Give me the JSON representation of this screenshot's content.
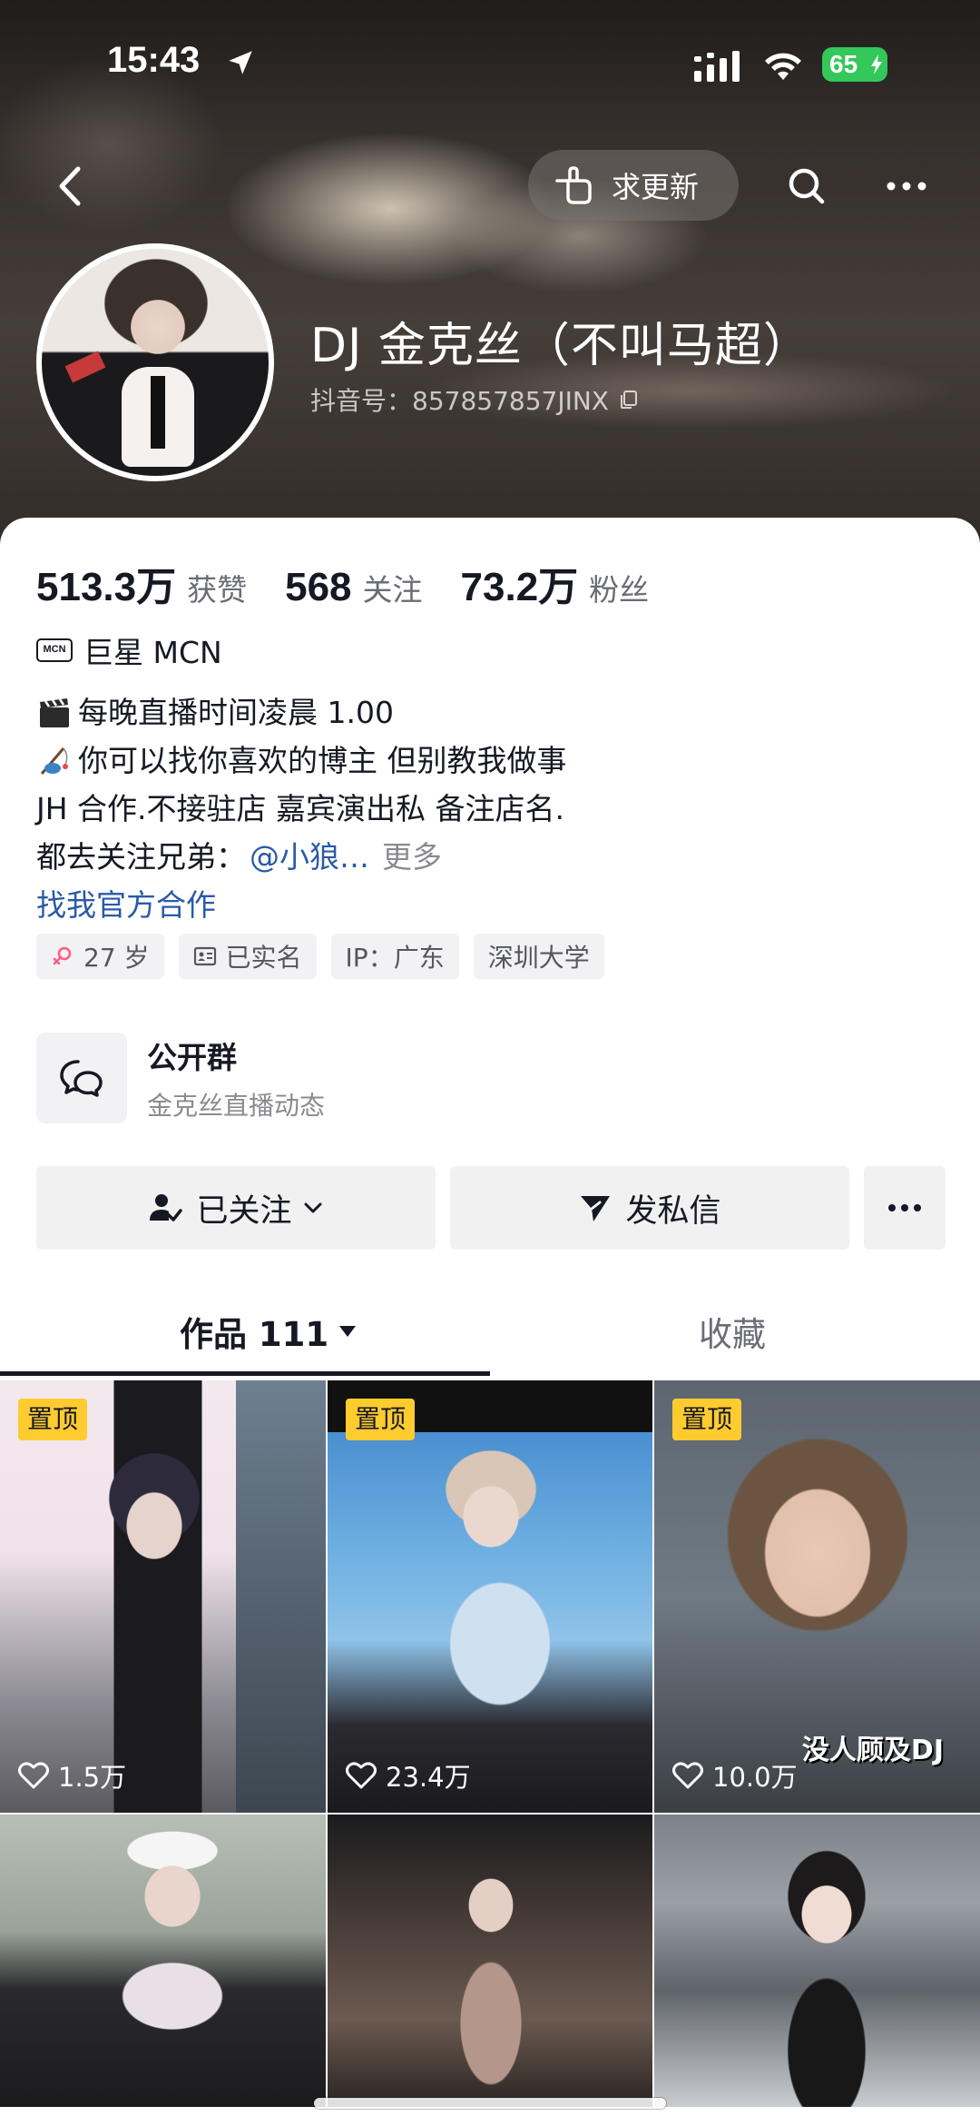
{
  "status_bar": {
    "time": "15:43",
    "battery": "65"
  },
  "header": {
    "update_label": "求更新"
  },
  "profile": {
    "name": "DJ 金克丝（不叫马超）",
    "douyin_id": "抖音号：857857857JINX"
  },
  "stats": [
    {
      "value": "513.3万",
      "label": "获赞"
    },
    {
      "value": "568",
      "label": "关注"
    },
    {
      "value": "73.2万",
      "label": "粉丝"
    }
  ],
  "mcn": {
    "badge": "MCN",
    "text": "巨星 MCN"
  },
  "bio": {
    "line1": "每晚直播时间凌晨 1.00",
    "line2": "你可以找你喜欢的博主 但别教我做事",
    "line3": "JH 合作.不接驻店 嘉宾演出私 备注店名.",
    "line4_prefix": "都去关注兄弟：",
    "line4_mention": "@小狼…",
    "line4_more": "更多",
    "collab_link": "找我官方合作"
  },
  "tags": [
    {
      "icon": "female-icon",
      "text": "27 岁"
    },
    {
      "icon": "id-card-icon",
      "text": "已实名"
    },
    {
      "icon": "",
      "text": "IP：广东"
    },
    {
      "icon": "",
      "text": "深圳大学"
    }
  ],
  "group": {
    "title": "公开群",
    "subtitle": "金克丝直播动态"
  },
  "actions": {
    "follow_label": "已关注",
    "message_label": "发私信"
  },
  "tabs": {
    "works_label": "作品 111",
    "favorites_label": "收藏"
  },
  "videos": [
    {
      "pinned": "置顶",
      "likes": "1.5万"
    },
    {
      "pinned": "置顶",
      "likes": "23.4万"
    },
    {
      "pinned": "置顶",
      "likes": "10.0万",
      "caption": "没人顾及DJ"
    },
    {},
    {},
    {}
  ],
  "colors": {
    "accent_link": "#2a5aa8",
    "pin_badge": "#fecc2f",
    "battery": "#34c759"
  }
}
